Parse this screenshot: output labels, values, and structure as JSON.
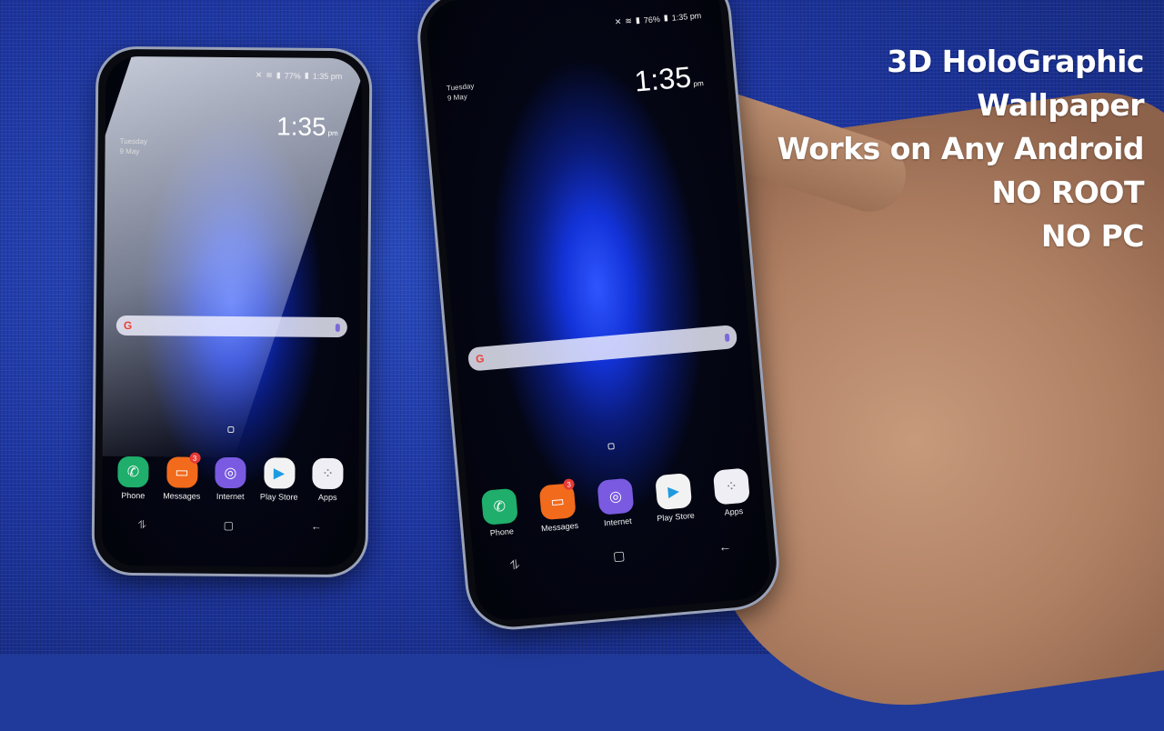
{
  "caption": {
    "lines": [
      "3D HoloGraphic",
      "Wallpaper",
      "Works on Any Android",
      "NO ROOT",
      "NO PC"
    ]
  },
  "phones": [
    {
      "id": "left",
      "status": {
        "battery": "77%",
        "time": "1:35 pm"
      },
      "date": {
        "day": "Tuesday",
        "date": "9 May"
      },
      "clock": {
        "time": "1:35",
        "ampm": "pm"
      },
      "search": {
        "icon": "google-g-icon",
        "g": "G"
      },
      "dock": [
        {
          "label": "Phone",
          "icon": "phone-icon",
          "color": "#1fae6b",
          "glyph": "✆"
        },
        {
          "label": "Messages",
          "icon": "message-icon",
          "color": "#f26a1b",
          "glyph": "▭",
          "badge": "3"
        },
        {
          "label": "Internet",
          "icon": "planet-icon",
          "color": "#7a5ae0",
          "glyph": "◎"
        },
        {
          "label": "Play Store",
          "icon": "play-store-icon",
          "color": "#f2f2f2",
          "glyph": "▶"
        },
        {
          "label": "Apps",
          "icon": "apps-grid-icon",
          "color": "#eeeef4",
          "glyph": "⁘"
        }
      ],
      "nav": {
        "recents": "⥮",
        "home": "▢",
        "back": "←"
      }
    },
    {
      "id": "right",
      "status": {
        "battery": "76%",
        "time": "1:35 pm"
      },
      "date": {
        "day": "Tuesday",
        "date": "9 May"
      },
      "clock": {
        "time": "1:35",
        "ampm": "pm"
      },
      "search": {
        "icon": "google-g-icon",
        "g": "G"
      },
      "dock": [
        {
          "label": "Phone",
          "icon": "phone-icon",
          "color": "#1fae6b",
          "glyph": "✆"
        },
        {
          "label": "Messages",
          "icon": "message-icon",
          "color": "#f26a1b",
          "glyph": "▭",
          "badge": "3"
        },
        {
          "label": "Internet",
          "icon": "planet-icon",
          "color": "#7a5ae0",
          "glyph": "◎"
        },
        {
          "label": "Play Store",
          "icon": "play-store-icon",
          "color": "#f2f2f2",
          "glyph": "▶"
        },
        {
          "label": "Apps",
          "icon": "apps-grid-icon",
          "color": "#eeeef4",
          "glyph": "⁘"
        }
      ],
      "nav": {
        "recents": "⥮",
        "home": "▢",
        "back": "←"
      }
    }
  ]
}
